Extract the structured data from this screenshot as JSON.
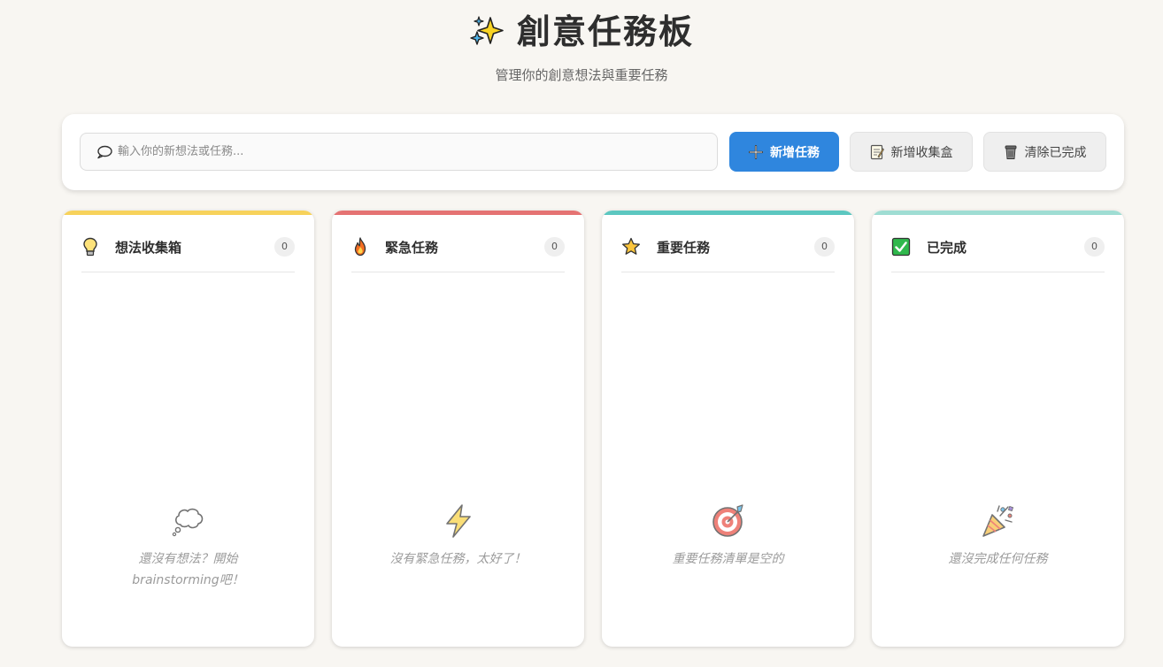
{
  "header": {
    "title": "創意任務板",
    "subtitle": "管理你的創意想法與重要任務"
  },
  "toolbar": {
    "input_placeholder": "輸入你的新想法或任務...",
    "input_value": "",
    "add_task_label": "新增任務",
    "add_collection_label": "新增收集盒",
    "clear_completed_label": "清除已完成"
  },
  "columns": [
    {
      "key": "ideas",
      "title": "想法收集箱",
      "count": "0",
      "icon": "lightbulb-icon",
      "accent": "#f7d25b",
      "empty_icon": "thought-bubble-icon",
      "empty_text": "還沒有想法？開始brainstorming吧！"
    },
    {
      "key": "urgent",
      "title": "緊急任務",
      "count": "0",
      "icon": "fire-icon",
      "accent": "#e57373",
      "empty_icon": "lightning-icon",
      "empty_text": "沒有緊急任務，太好了！"
    },
    {
      "key": "important",
      "title": "重要任務",
      "count": "0",
      "icon": "star-icon",
      "accent": "#5cc7c0",
      "empty_icon": "target-icon",
      "empty_text": "重要任務清單是空的"
    },
    {
      "key": "done",
      "title": "已完成",
      "count": "0",
      "icon": "checkbox-icon",
      "accent": "#9fddd3",
      "empty_icon": "party-popper-icon",
      "empty_text": "還沒完成任何任務"
    }
  ],
  "colors": {
    "background": "#f8f6f2",
    "primary_button": "#2f86de"
  }
}
